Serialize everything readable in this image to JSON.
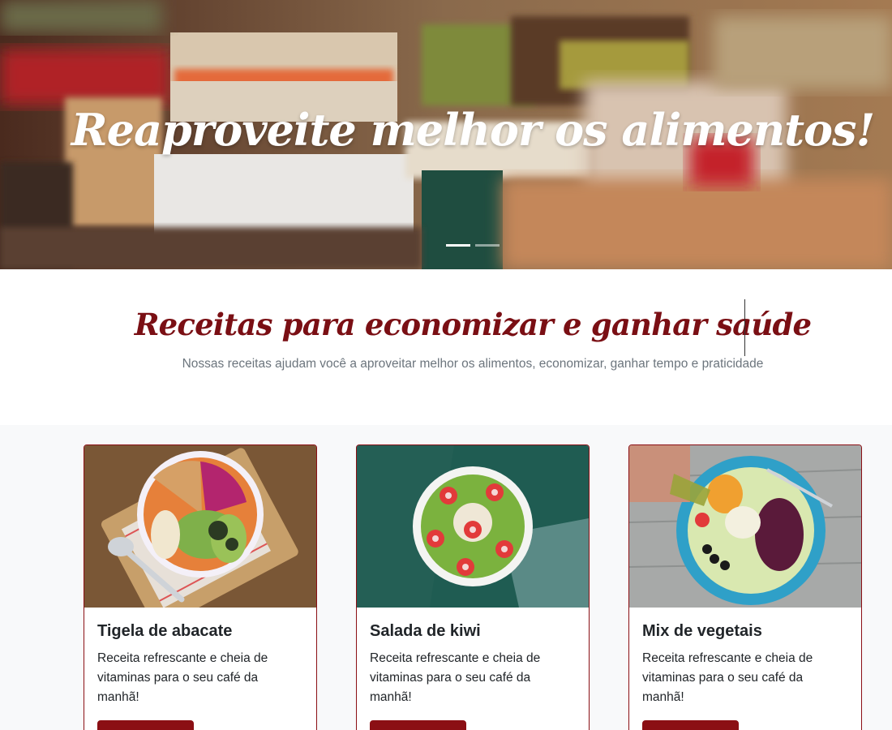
{
  "hero": {
    "title": "Reaproveite melhor os alimentos!",
    "slides": [
      {
        "active": true
      },
      {
        "active": false
      }
    ]
  },
  "intro": {
    "title": "Receitas para economizar e ganhar saúde",
    "subtitle": "Nossas receitas ajudam você a aproveitar melhor os alimentos, economizar, ganhar tempo e praticidade"
  },
  "cards": [
    {
      "title": "Tigela de abacate",
      "text": "Receita refrescante e cheia de vitaminas para o seu café da manhã!",
      "image": "avocado-bowl-image"
    },
    {
      "title": "Salada de kiwi",
      "text": "Receita refrescante e cheia de vitaminas para o seu café da manhã!",
      "image": "kiwi-bowl-image"
    },
    {
      "title": "Mix de vegetais",
      "text": "Receita refrescante e cheia de vitaminas para o seu café da manhã!",
      "image": "vegetable-plate-image"
    }
  ],
  "colors": {
    "accent": "#8b0f14",
    "title": "#7a0f14",
    "muted": "#6c757d",
    "section_bg": "#f8f9fa"
  }
}
